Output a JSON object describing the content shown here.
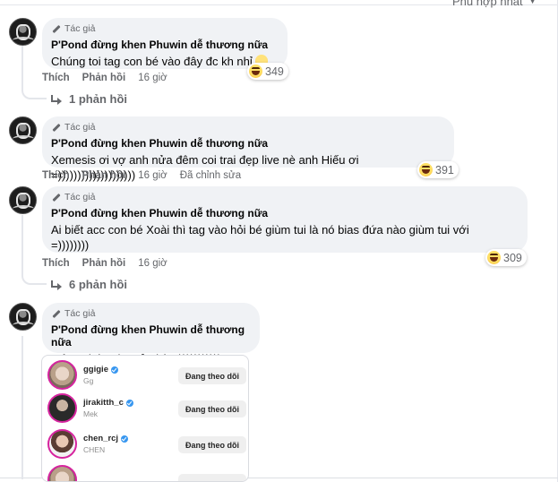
{
  "sort": {
    "label": "Phù hợp nhất"
  },
  "author_badge": "Tác giả",
  "comments": [
    {
      "name": "P'Pond đừng khen Phuwin dễ thương nữa",
      "text": "Chúng toi tag con bé vào đây đc kh nhỉ",
      "reaction_count": "349",
      "like": "Thích",
      "reply": "Phản hồi",
      "time": "16 giờ",
      "replies": "1 phản hồi"
    },
    {
      "name": "P'Pond đừng khen Phuwin dễ thương nữa",
      "text": "Xemesis ơi vợ anh nửa đêm coi trai đẹp live nè anh Hiếu ơi =))))))))))))))))))))",
      "reaction_count": "391",
      "like": "Thích",
      "reply": "Phản hồi",
      "time": "16 giờ",
      "edited": "Đã chỉnh sửa"
    },
    {
      "name": "P'Pond đừng khen Phuwin dễ thương nữa",
      "text_line1": "Ai biết acc con bé Xoài thì tag vào hỏi bé giùm tui là nó bias đứa nào giùm tui với",
      "text_line2": "=))))))))",
      "reaction_count": "309",
      "like": "Thích",
      "reply": "Phản hồi",
      "time": "16 giờ",
      "replies": "6 phản hồi"
    },
    {
      "name": "P'Pond đừng khen Phuwin dễ thương nữa",
      "text": "Mê A Chén nha cả nhà =)))))))))))"
    }
  ],
  "attachment": {
    "rows": [
      {
        "username": "ggigie",
        "sub": "Gg",
        "button": "Đang theo dõi"
      },
      {
        "username": "jirakitth_c",
        "sub": "Mek",
        "button": "Đang theo dõi"
      },
      {
        "username": "chen_rcj",
        "sub": "CHEN",
        "button": "Đang theo dõi"
      }
    ]
  }
}
